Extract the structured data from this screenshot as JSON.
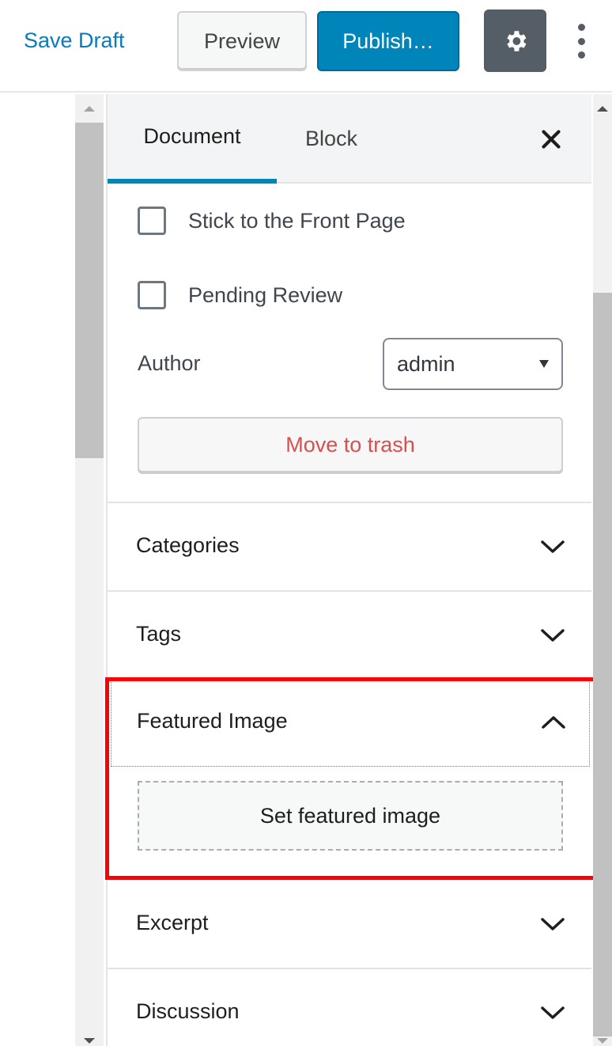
{
  "toolbar": {
    "save_draft": "Save Draft",
    "preview": "Preview",
    "publish": "Publish…",
    "settings_icon": "gear-icon",
    "more_icon": "vertical-ellipsis-icon"
  },
  "sidebar": {
    "tabs": [
      {
        "label": "Document",
        "active": true
      },
      {
        "label": "Block",
        "active": false
      }
    ],
    "close_icon": "close-icon",
    "checkboxes": [
      {
        "label": "Stick to the Front Page",
        "checked": false
      },
      {
        "label": "Pending Review",
        "checked": false
      }
    ],
    "author": {
      "label": "Author",
      "selected": "admin"
    },
    "trash_label": "Move to trash",
    "panels": [
      {
        "title": "Categories",
        "expanded": false
      },
      {
        "title": "Tags",
        "expanded": false
      },
      {
        "title": "Featured Image",
        "expanded": true,
        "action": "Set featured image"
      },
      {
        "title": "Excerpt",
        "expanded": false
      },
      {
        "title": "Discussion",
        "expanded": false
      }
    ]
  },
  "colors": {
    "accent": "#0085ba",
    "link": "#0a7bba",
    "danger": "#d94f4f",
    "highlight": "#ff0000"
  }
}
